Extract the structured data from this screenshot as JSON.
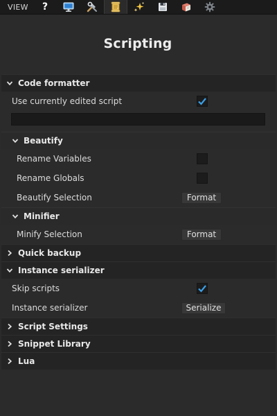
{
  "toolbar": {
    "view_label": "VIEW",
    "help_label": "?",
    "icons": [
      "help-icon",
      "monitor-icon",
      "tools-icon",
      "scroll-icon",
      "sparkle-icon",
      "floppy-disk-icon",
      "book-icon",
      "gear-icon"
    ],
    "active_tab": "scroll-icon"
  },
  "page": {
    "title": "Scripting"
  },
  "code_formatter": {
    "header": "Code formatter",
    "use_current_label": "Use currently edited script",
    "use_current_checked": true,
    "script_path_value": "",
    "beautify": {
      "header": "Beautify",
      "rename_variables_label": "Rename Variables",
      "rename_variables_checked": false,
      "rename_globals_label": "Rename Globals",
      "rename_globals_checked": false,
      "beautify_selection_label": "Beautify Selection",
      "beautify_button": "Format"
    },
    "minifier": {
      "header": "Minifier",
      "minify_selection_label": "Minify Selection",
      "minify_button": "Format"
    }
  },
  "quick_backup": {
    "header": "Quick backup"
  },
  "instance_serializer": {
    "header": "Instance serializer",
    "skip_scripts_label": "Skip scripts",
    "skip_scripts_checked": true,
    "serializer_label": "Instance serializer",
    "serialize_button": "Serialize"
  },
  "script_settings": {
    "header": "Script Settings"
  },
  "snippet_library": {
    "header": "Snippet Library"
  },
  "lua": {
    "header": "Lua"
  },
  "colors": {
    "background": "#2b2b2b",
    "toolbar": "#1b1b1b",
    "checkmark": "#3aa0e8",
    "section_header": "#242424"
  }
}
